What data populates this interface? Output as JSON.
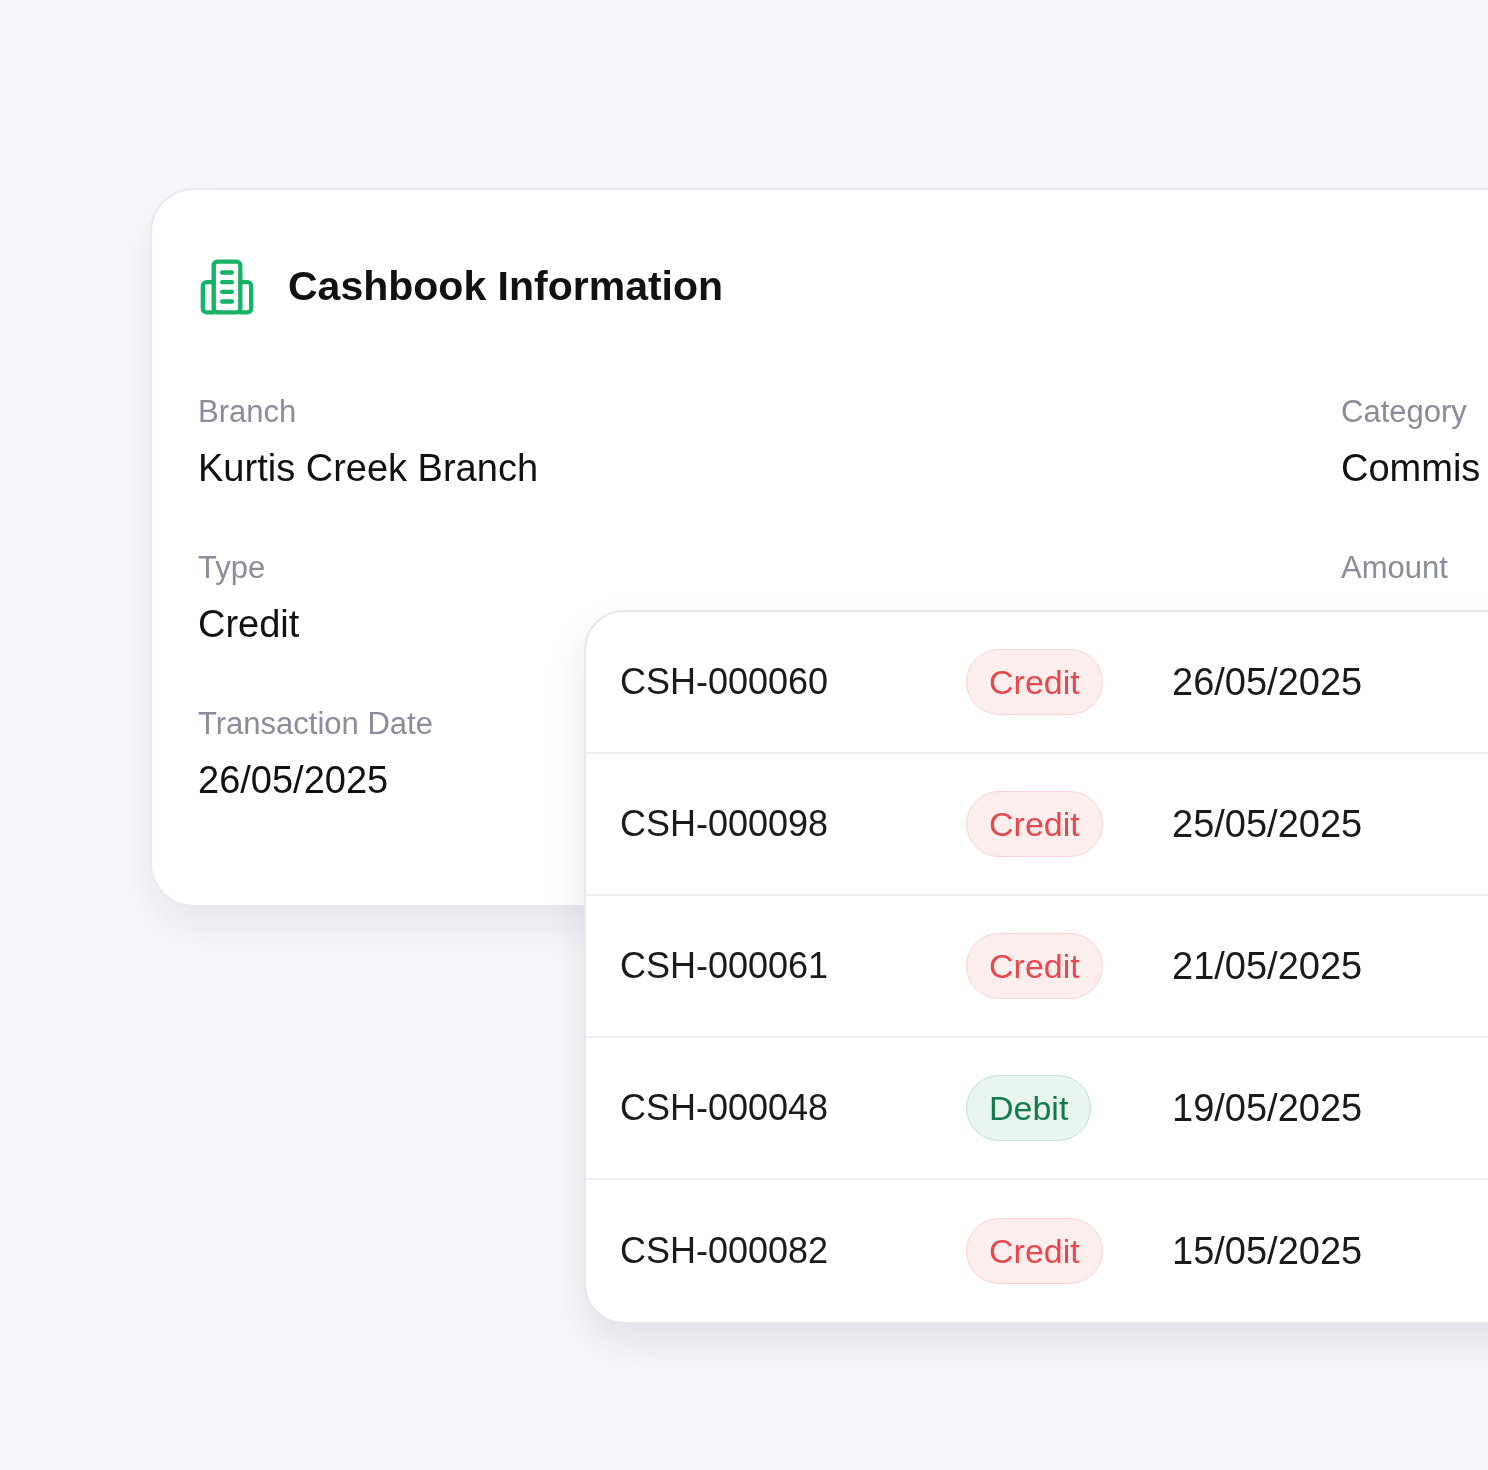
{
  "card": {
    "title": "Cashbook Information",
    "fields": [
      {
        "label": "Branch",
        "value": "Kurtis Creek Branch"
      },
      {
        "label": "Category",
        "value": "Commis"
      },
      {
        "label": "Type",
        "value": "Credit"
      },
      {
        "label": "Amount"
      },
      {
        "label": "Transaction Date",
        "value": "26/05/2025"
      }
    ]
  },
  "table": {
    "rows": [
      {
        "id": "CSH-000060",
        "type": "Credit",
        "kind": "credit",
        "date": "26/05/2025"
      },
      {
        "id": "CSH-000098",
        "type": "Credit",
        "kind": "credit",
        "date": "25/05/2025"
      },
      {
        "id": "CSH-000061",
        "type": "Credit",
        "kind": "credit",
        "date": "21/05/2025"
      },
      {
        "id": "CSH-000048",
        "type": "Debit",
        "kind": "debit",
        "date": "19/05/2025"
      },
      {
        "id": "CSH-000082",
        "type": "Credit",
        "kind": "credit",
        "date": "15/05/2025"
      }
    ]
  }
}
